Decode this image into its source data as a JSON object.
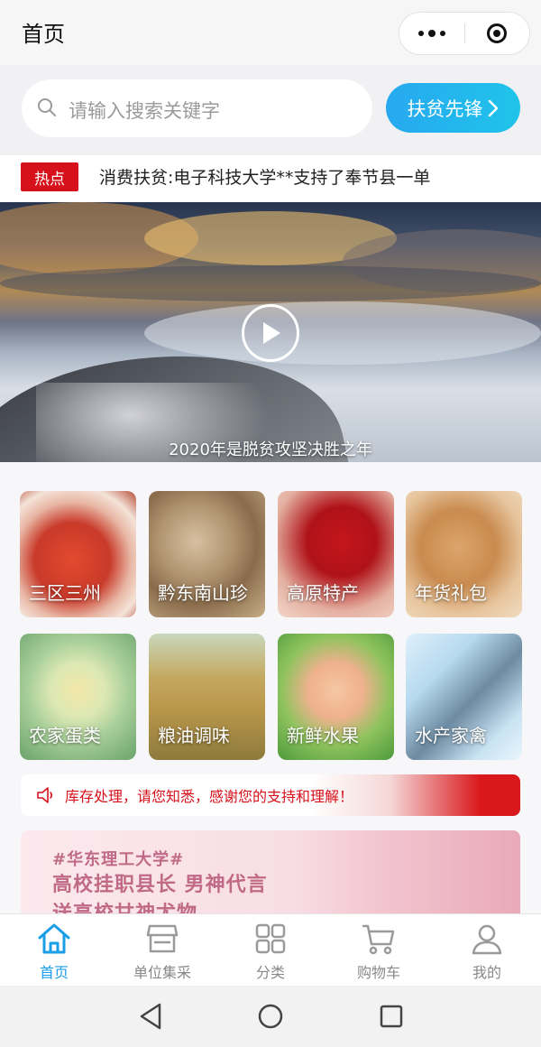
{
  "header": {
    "title": "首页"
  },
  "search": {
    "placeholder": "请输入搜索关键字",
    "pioneer_label": "扶贫先锋"
  },
  "hot": {
    "badge": "热点",
    "headline": "消费扶贫:电子科技大学**支持了奉节县一单"
  },
  "banner": {
    "caption": "2020年是脱贫攻坚决胜之年"
  },
  "categories": [
    {
      "label": "三区三州",
      "icon": "goji-berry-image"
    },
    {
      "label": "黔东南山珍",
      "icon": "mushroom-image"
    },
    {
      "label": "高原特产",
      "icon": "saffron-image"
    },
    {
      "label": "年货礼包",
      "icon": "walnut-image"
    },
    {
      "label": "农家蛋类",
      "icon": "egg-image"
    },
    {
      "label": "粮油调味",
      "icon": "rice-image"
    },
    {
      "label": "新鲜水果",
      "icon": "peach-image"
    },
    {
      "label": "水产家禽",
      "icon": "fish-image"
    }
  ],
  "notice": {
    "text": "库存处理，请您知悉，感谢您的支持和理解！"
  },
  "promo": {
    "line1": "#华东理工大学#",
    "line2": "高校挂职县长 男神代言",
    "line3": "送高校甘神尤物"
  },
  "tabs": [
    {
      "label": "首页",
      "icon": "home-icon",
      "active": true
    },
    {
      "label": "单位集采",
      "icon": "store-icon",
      "active": false
    },
    {
      "label": "分类",
      "icon": "grid-icon",
      "active": false
    },
    {
      "label": "购物车",
      "icon": "cart-icon",
      "active": false
    },
    {
      "label": "我的",
      "icon": "user-icon",
      "active": false
    }
  ],
  "colors": {
    "accent": "#1b9ee8",
    "hot": "#d6111b",
    "tab_inactive": "#888888"
  }
}
